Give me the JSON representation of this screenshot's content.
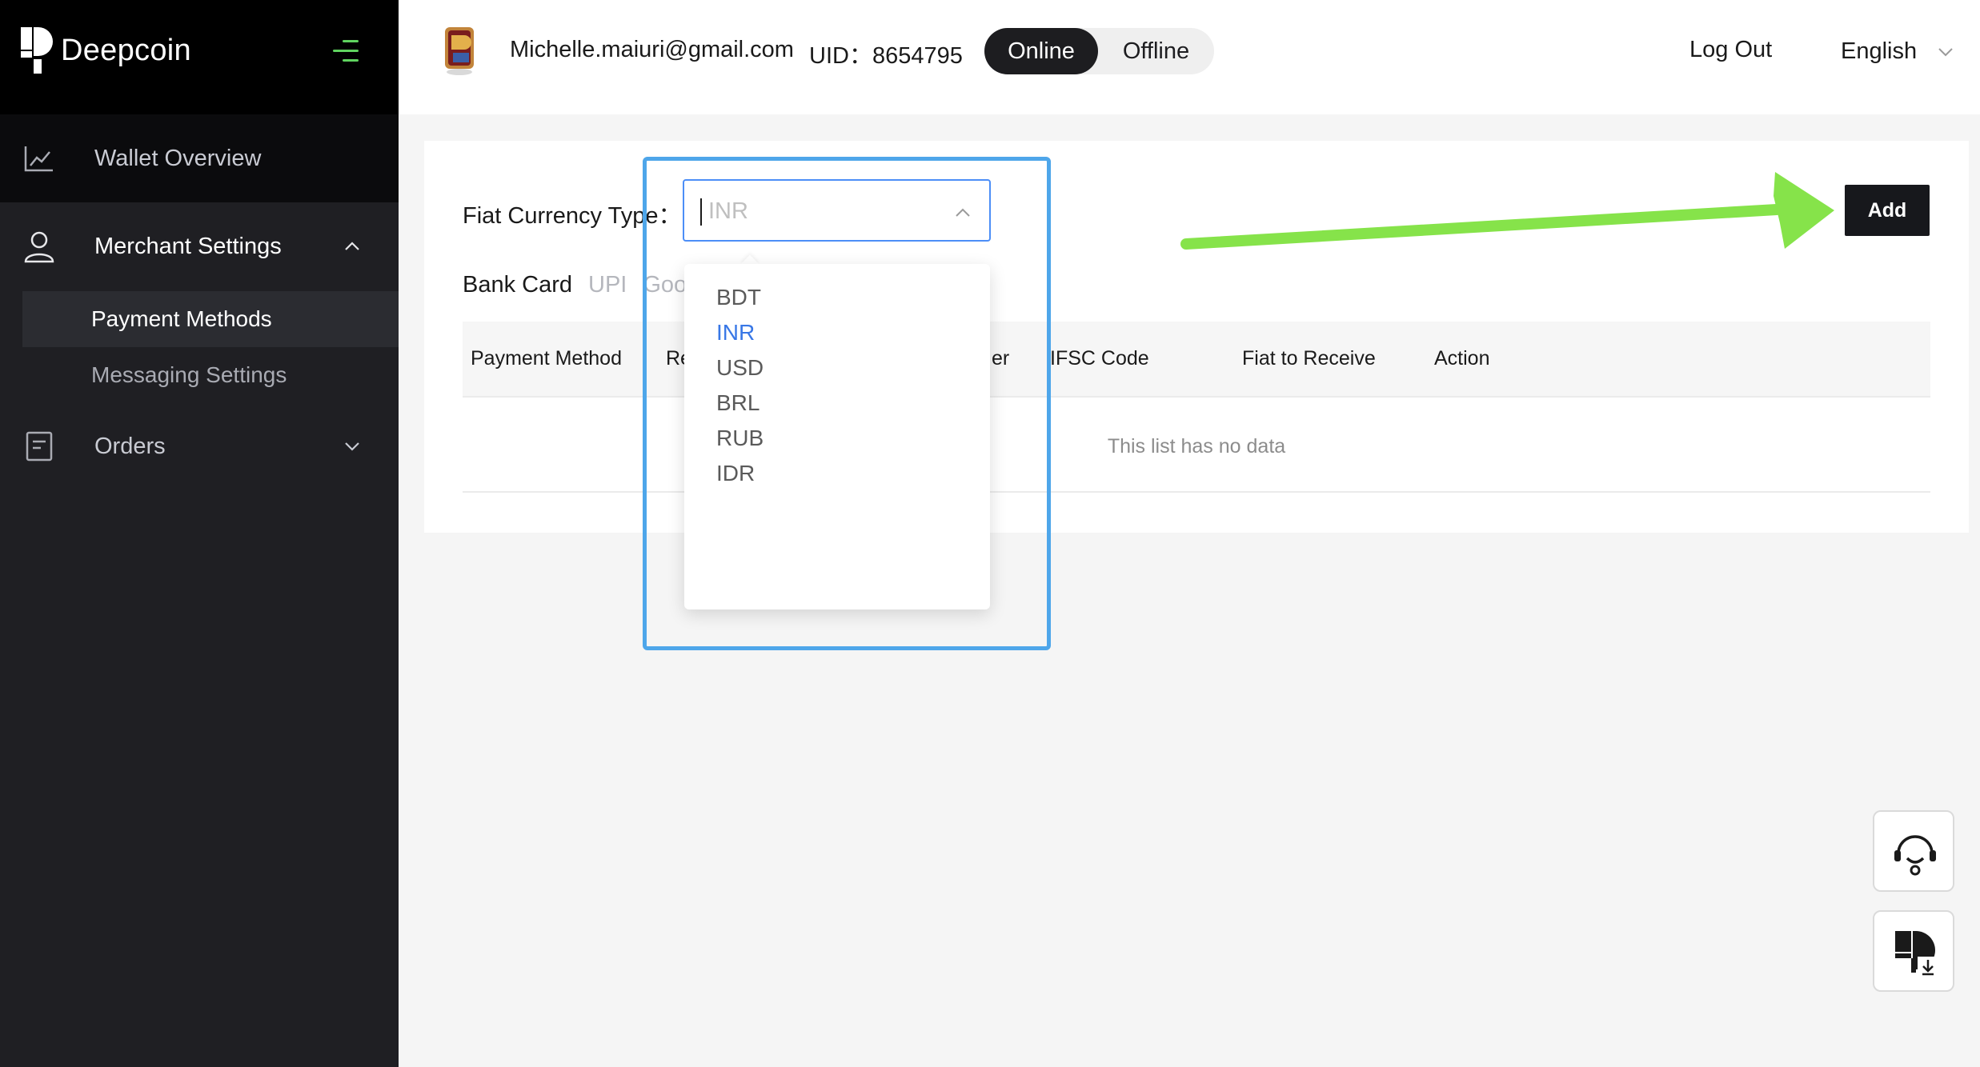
{
  "brand": {
    "name": "Deepcoin"
  },
  "sidebar": {
    "items": [
      {
        "label": "Wallet Overview",
        "icon": "chart-line-icon"
      },
      {
        "label": "Merchant Settings",
        "icon": "user-icon",
        "expanded": true,
        "children": [
          {
            "label": "Payment Methods",
            "active": true
          },
          {
            "label": "Messaging Settings"
          }
        ]
      },
      {
        "label": "Orders",
        "icon": "document-icon",
        "expanded": false
      }
    ]
  },
  "header": {
    "email": "Michelle.maiuri@gmail.com",
    "uid": "UID：8654795",
    "status": {
      "online": "Online",
      "offline": "Offline",
      "selected": "Online"
    },
    "logout": "Log Out",
    "language": "English"
  },
  "filter": {
    "label": "Fiat Currency Type：",
    "value": "INR"
  },
  "tabs": [
    {
      "label": "Bank Card",
      "active": true
    },
    {
      "label": "UPI",
      "active": false
    },
    {
      "label": "Goo",
      "active": false
    }
  ],
  "table": {
    "columns": [
      "Payment Method",
      "Re",
      "er",
      "IFSC Code",
      "Fiat to Receive",
      "Action"
    ],
    "empty_text": "This list has no data"
  },
  "add_button": "Add",
  "dropdown": {
    "options": [
      "BDT",
      "INR",
      "USD",
      "BRL",
      "RUB",
      "IDR"
    ],
    "selected": "INR"
  },
  "colors": {
    "sidebar_bg": "#1f1f23",
    "accent_green": "#5fd35f",
    "select_border": "#4c8ef7",
    "selected_option": "#3877e6",
    "annotation_box": "#4ea6ea",
    "annotation_arrow": "#86e34a"
  }
}
